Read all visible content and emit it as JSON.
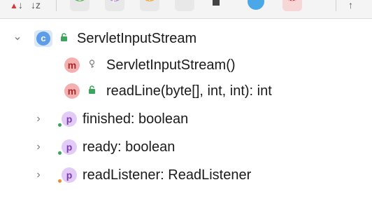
{
  "toolbar": {
    "sort_alpha_icon": "sort-type-icon",
    "sort_z_label": "↓z",
    "buttons": [
      "class-filter",
      "property-filter",
      "interface-filter",
      "field-filter",
      "square-filter",
      "blue-circle-filter",
      "lambda-filter",
      "pin-filter"
    ]
  },
  "tree": {
    "root": {
      "label": "ServletInputStream",
      "badge": "c",
      "expanded": true
    },
    "methods": [
      {
        "badge": "m",
        "label": "ServletInputStream()",
        "access": "protected"
      },
      {
        "badge": "m",
        "label": "readLine(byte[], int, int): int",
        "access": "public"
      }
    ],
    "properties": [
      {
        "badge": "p",
        "label": "finished: boolean",
        "access": "public"
      },
      {
        "badge": "p",
        "label": "ready: boolean",
        "access": "public"
      },
      {
        "badge": "p",
        "label": "readListener: ReadListener",
        "access": "package"
      }
    ]
  },
  "colors": {
    "class_badge": "#5c9ce8",
    "method_badge": "#f4b0b0",
    "property_badge": "#e2cbf7",
    "public_green": "#3aa55c",
    "package_orange": "#f08c2a"
  }
}
